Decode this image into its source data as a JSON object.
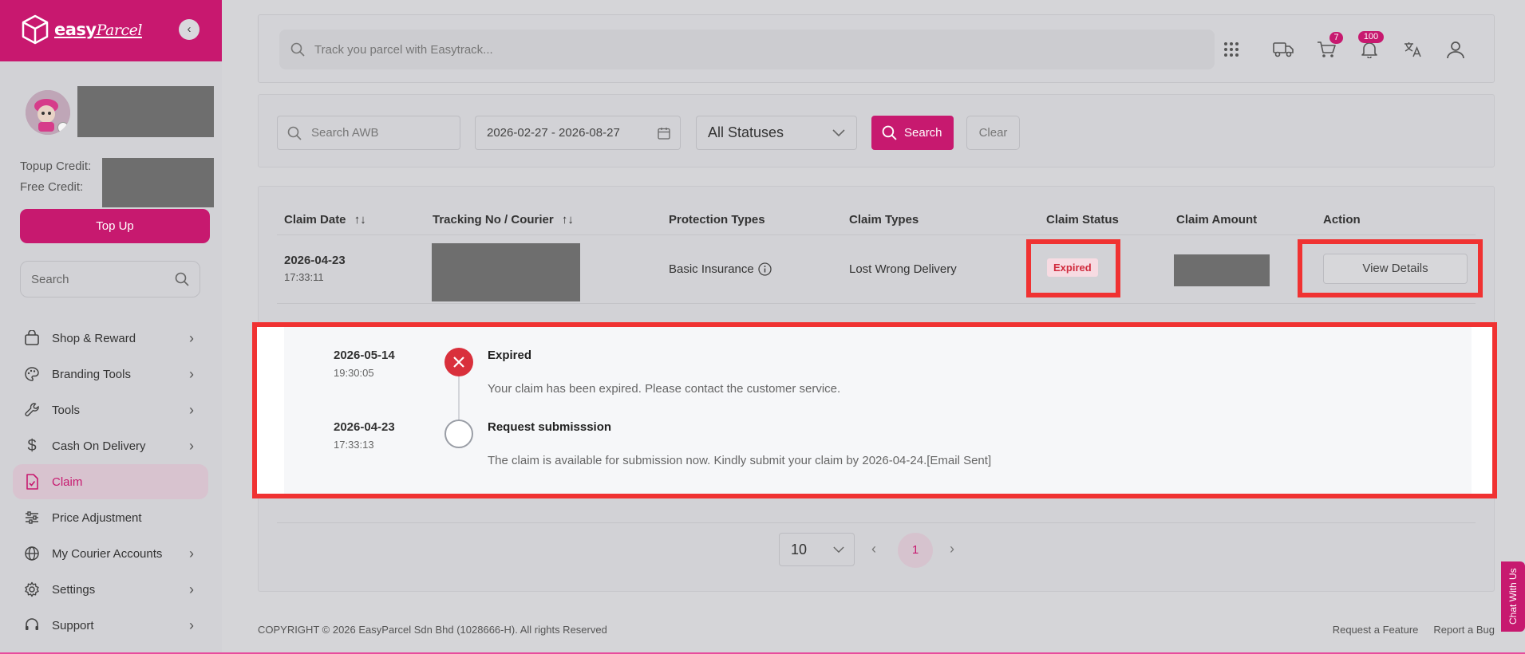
{
  "brand": {
    "name": "easy",
    "name_script": "Parcel",
    "colors": {
      "primary": "#c7196f",
      "highlight": "#f03232"
    }
  },
  "sidebar": {
    "collapse_icon": "chevron-left-icon",
    "topup_credit_label": "Topup Credit:",
    "free_credit_label": "Free Credit:",
    "topup_button": "Top Up",
    "search_placeholder": "Search",
    "items": [
      {
        "label": "Shop & Reward",
        "icon": "shopping-bag-icon",
        "has_children": true
      },
      {
        "label": "Branding Tools",
        "icon": "palette-icon",
        "has_children": true
      },
      {
        "label": "Tools",
        "icon": "wrench-icon",
        "has_children": true
      },
      {
        "label": "Cash On Delivery",
        "icon": "dollar-icon",
        "has_children": true
      },
      {
        "label": "Claim",
        "icon": "claim-document-icon",
        "has_children": false,
        "active": true
      },
      {
        "label": "Price Adjustment",
        "icon": "sliders-icon",
        "has_children": false
      },
      {
        "label": "My Courier Accounts",
        "icon": "globe-icon",
        "has_children": true
      },
      {
        "label": "Settings",
        "icon": "gear-icon",
        "has_children": true
      },
      {
        "label": "Support",
        "icon": "headset-icon",
        "has_children": true
      }
    ]
  },
  "topbar": {
    "track_placeholder": "Track you parcel with Easytrack...",
    "cart_badge": "7",
    "notification_badge": "100"
  },
  "filters": {
    "awb_placeholder": "Search AWB",
    "date_range": "2026-02-27 - 2026-08-27",
    "status_selected": "All Statuses",
    "search_button": "Search",
    "clear_button": "Clear"
  },
  "table": {
    "headers": {
      "claim_date": "Claim Date",
      "tracking": "Tracking No / Courier",
      "protection": "Protection Types",
      "claim_types": "Claim Types",
      "claim_status": "Claim Status",
      "claim_amount": "Claim Amount",
      "action": "Action"
    },
    "row": {
      "date": "2026-04-23",
      "time": "17:33:11",
      "protection": "Basic Insurance",
      "claim_type": "Lost Wrong Delivery",
      "status": "Expired",
      "action": "View Details"
    }
  },
  "timeline": [
    {
      "date": "2026-05-14",
      "time": "19:30:05",
      "title": "Expired",
      "description": "Your claim has been expired. Please contact the customer service.",
      "state": "failed"
    },
    {
      "date": "2026-04-23",
      "time": "17:33:13",
      "title": "Request submisssion",
      "description": "The claim is available for submission now. Kindly submit your claim by 2026-04-24.[Email Sent]",
      "state": "pending"
    }
  ],
  "pagination": {
    "page_size": "10",
    "current_page": "1"
  },
  "footer": {
    "copyright": "COPYRIGHT © 2026 EasyParcel Sdn Bhd (1028666-H). All rights Reserved",
    "request_feature": "Request a Feature",
    "report_bug": "Report a Bug"
  },
  "chat_tab": "Chat With Us"
}
